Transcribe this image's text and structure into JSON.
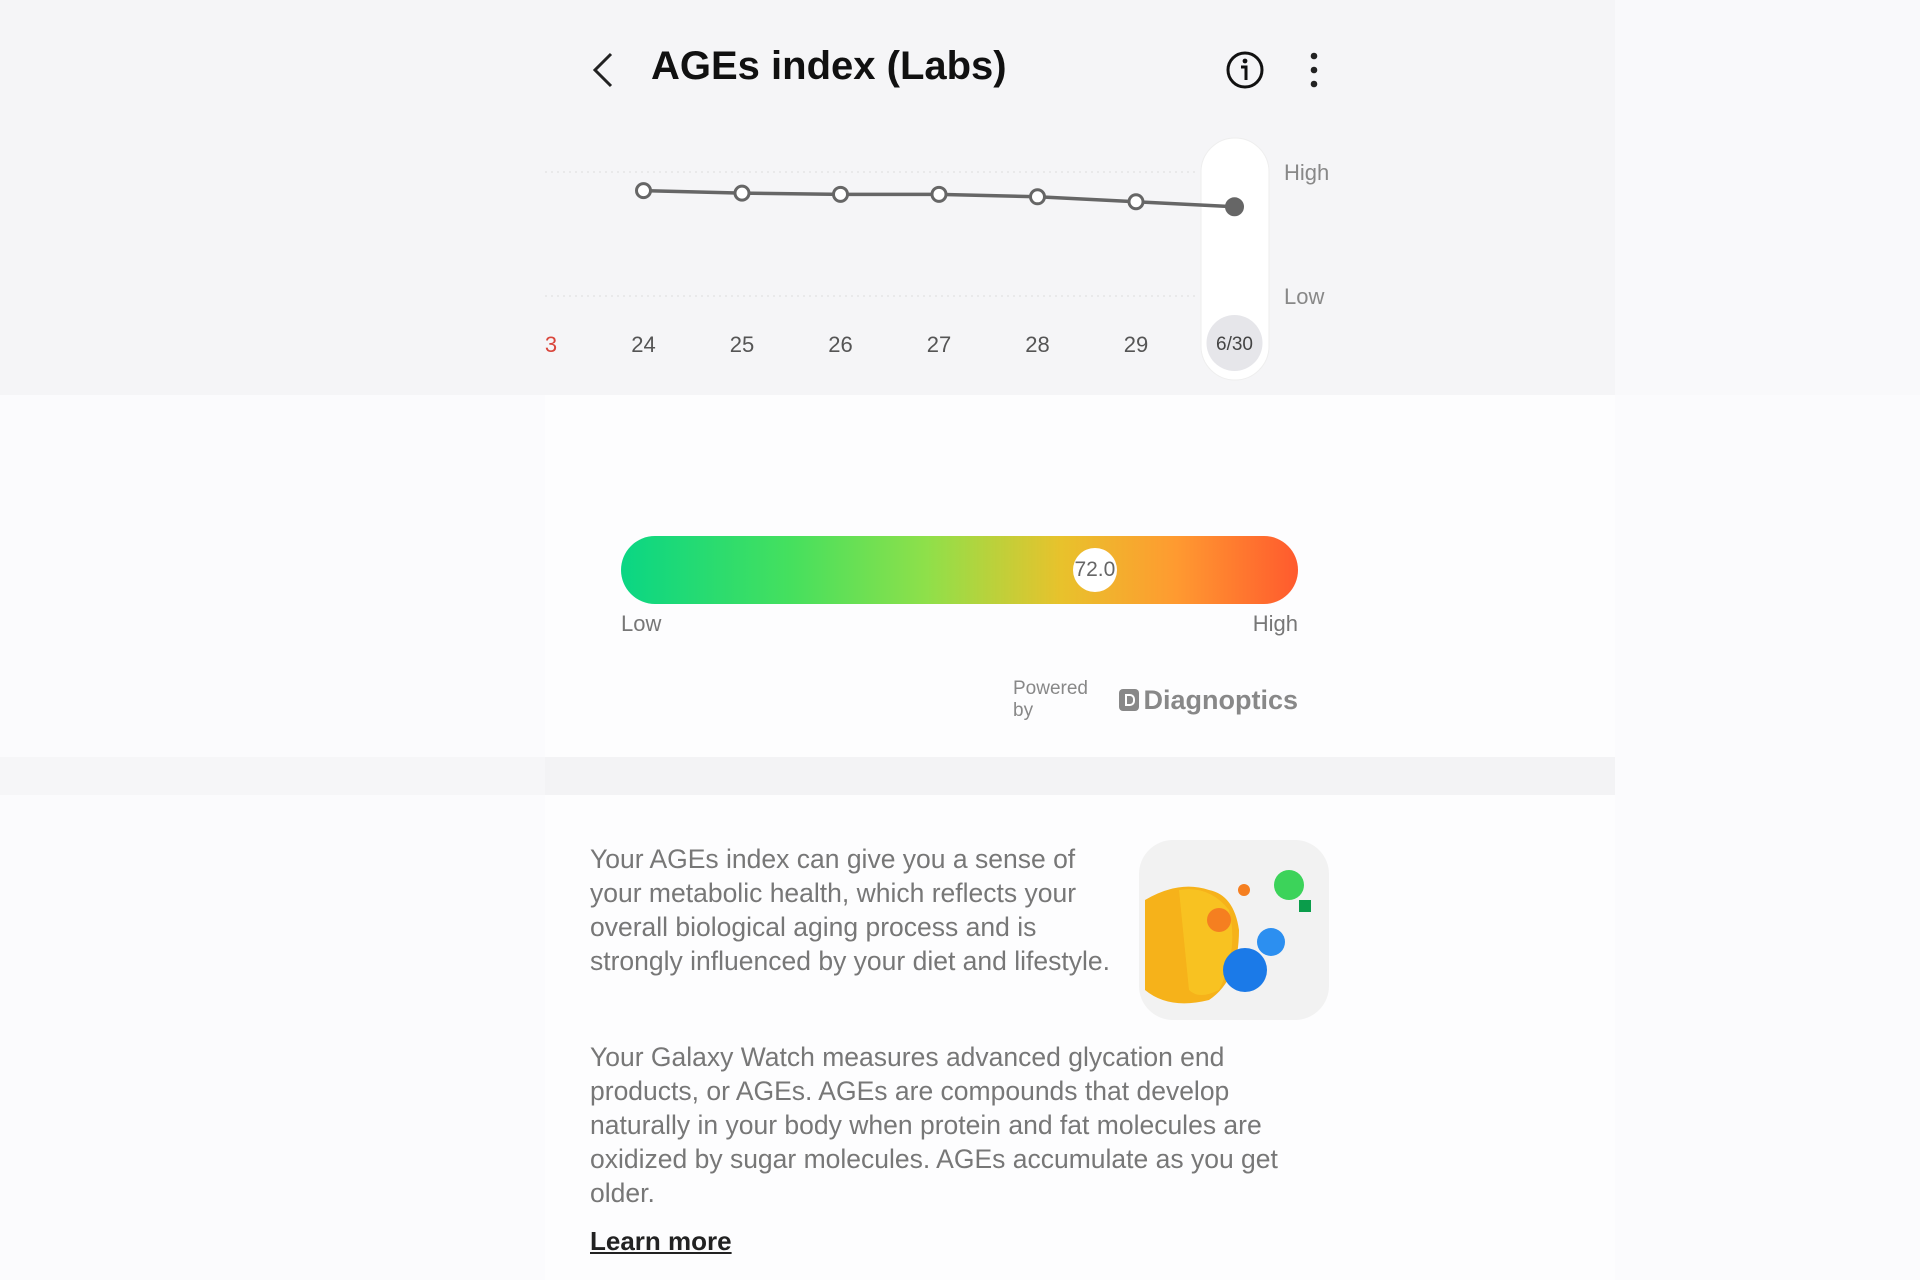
{
  "header": {
    "title": "AGEs index (Labs)",
    "back_icon": "chevron-left-icon",
    "info_icon": "info-icon",
    "more_icon": "more-vertical-icon"
  },
  "chart_data": {
    "type": "line",
    "categories": [
      "3",
      "24",
      "25",
      "26",
      "27",
      "28",
      "29",
      "6/30"
    ],
    "series": [
      {
        "values": [
          null,
          85,
          83,
          82,
          82,
          80,
          76,
          72
        ]
      }
    ],
    "y_labels": {
      "high": "High",
      "low": "Low"
    },
    "ylim": [
      0,
      100
    ],
    "selected": "6/30",
    "grid": true,
    "colors": {
      "line": "#666666",
      "weekend_label": "#d9453b"
    }
  },
  "gauge": {
    "value": 72.0,
    "value_label": "72.0",
    "fraction": 0.7,
    "low_label": "Low",
    "high_label": "High",
    "colors": [
      "#0ad684",
      "#8ee04a",
      "#f4c02a",
      "#ff5a2e"
    ]
  },
  "powered": {
    "label": "Powered by",
    "brand": "Diagnoptics"
  },
  "description": {
    "p1": "Your AGEs index can give you a sense of your metabolic health, which reflects your overall biological aging process and is strongly influenced by your diet and lifestyle.",
    "p2": "Your Galaxy Watch measures advanced glycation end products, or AGEs. AGEs are compounds that develop naturally in your body when protein and fat molecules are oxidized by sugar molecules. AGEs accumulate as you get older.",
    "learn_more": "Learn more"
  }
}
